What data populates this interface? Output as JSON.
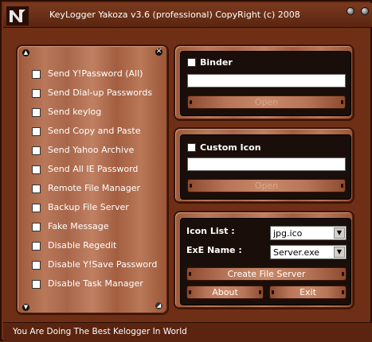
{
  "window": {
    "title": "KeyLogger Yakoza v3.6 (professional) CopyRight (c) 2008",
    "status": "You Are Doing The Best Kelogger In World"
  },
  "options": [
    {
      "label": "Send Y!Password (All)",
      "checked": false
    },
    {
      "label": "Send Dial-up Passwords",
      "checked": false
    },
    {
      "label": "Send keylog",
      "checked": false
    },
    {
      "label": "Send Copy and Paste",
      "checked": false
    },
    {
      "label": "Send Yahoo Archive",
      "checked": false
    },
    {
      "label": "Send All IE Password",
      "checked": false
    },
    {
      "label": "Remote File Manager",
      "checked": false
    },
    {
      "label": "Backup File Server",
      "checked": false
    },
    {
      "label": "Fake Message",
      "checked": false
    },
    {
      "label": "Disable Regedit",
      "checked": false
    },
    {
      "label": "Disable Y!Save Password",
      "checked": false
    },
    {
      "label": "Disable Task Manager",
      "checked": false
    }
  ],
  "binder": {
    "label": "Binder",
    "checked": false,
    "path": "",
    "open_label": "Open"
  },
  "custom_icon": {
    "label": "Custom Icon",
    "checked": false,
    "path": "",
    "open_label": "Open"
  },
  "server": {
    "icon_list_label": "Icon List  :",
    "icon_list_value": "jpg.ico",
    "exe_name_label": "ExE Name  :",
    "exe_name_value": "Server.exe",
    "create_label": "Create File Server",
    "about_label": "About",
    "exit_label": "Exit"
  },
  "colors": {
    "wood": "#b9785a",
    "dark_panel": "#1a0e0a",
    "frame_bg": "#6e2f16"
  }
}
